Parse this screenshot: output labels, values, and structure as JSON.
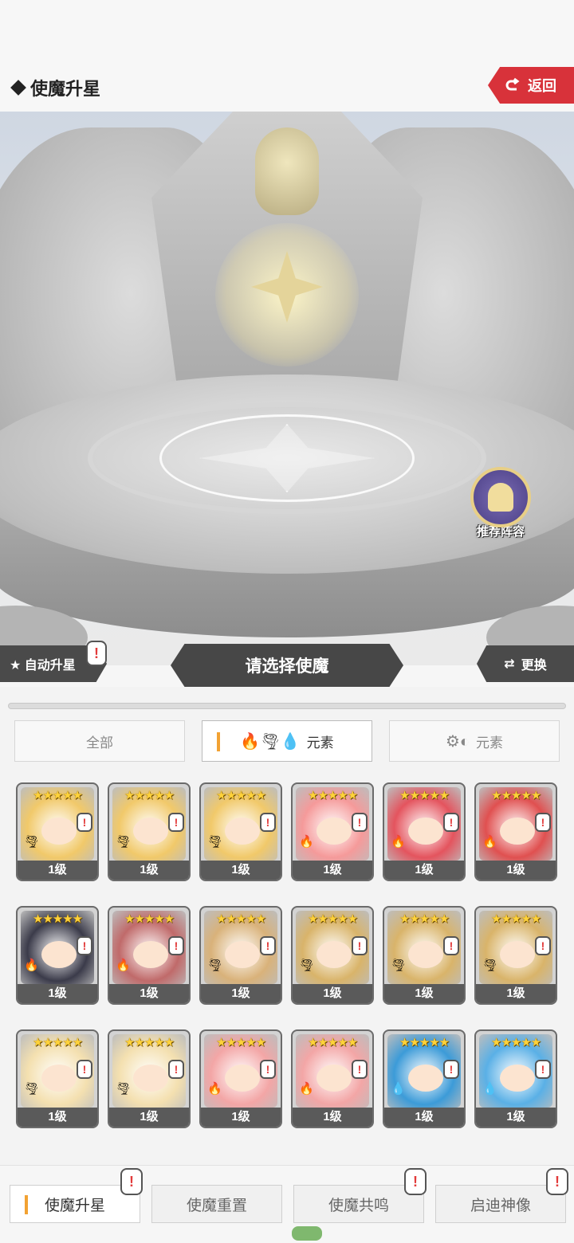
{
  "header": {
    "title": "使魔升星",
    "back_label": "返回"
  },
  "scene": {
    "recommend_label": "推荐阵容"
  },
  "actions": {
    "auto_label": "★ 自动升星",
    "select_label": "请选择使魔",
    "switch_label": "更换",
    "alert_mark": "!"
  },
  "filters": [
    {
      "label": "全部",
      "icons": ""
    },
    {
      "label": "元素",
      "icons": "🔥🌪💧"
    },
    {
      "label": "元素",
      "icons": "⚙◐"
    }
  ],
  "cards": [
    {
      "stars": "★★★★★",
      "level": "1级",
      "element": "🌪",
      "hair": "#f1c96a"
    },
    {
      "stars": "★★★★★",
      "level": "1级",
      "element": "🌪",
      "hair": "#f1c96a"
    },
    {
      "stars": "★★★★★",
      "level": "1级",
      "element": "🌪",
      "hair": "#f1c96a"
    },
    {
      "stars": "★★★★★",
      "level": "1级",
      "element": "🔥",
      "hair": "#f59a9a"
    },
    {
      "stars": "★★★★★",
      "level": "1级",
      "element": "🔥",
      "hair": "#e4545e"
    },
    {
      "stars": "★★★★★",
      "level": "1级",
      "element": "🔥",
      "hair": "#e05050"
    },
    {
      "stars": "★★★★★",
      "level": "1级",
      "element": "🔥",
      "hair": "#3b3b4a"
    },
    {
      "stars": "★★★★★",
      "level": "1级",
      "element": "🔥",
      "hair": "#c06a6a"
    },
    {
      "stars": "★★★★★",
      "level": "1级",
      "element": "🌪",
      "hair": "#d9b27a"
    },
    {
      "stars": "★★★★★",
      "level": "1级",
      "element": "🌪",
      "hair": "#d9b46a"
    },
    {
      "stars": "★★★★★",
      "level": "1级",
      "element": "🌪",
      "hair": "#d9b46a"
    },
    {
      "stars": "★★★★★",
      "level": "1级",
      "element": "🌪",
      "hair": "#d9b46a"
    },
    {
      "stars": "★★★★★",
      "level": "1级",
      "element": "🌪",
      "hair": "#f4e0b0"
    },
    {
      "stars": "★★★★★",
      "level": "1级",
      "element": "🌪",
      "hair": "#f4e0b0"
    },
    {
      "stars": "★★★★★",
      "level": "1级",
      "element": "🔥",
      "hair": "#f3a6a6"
    },
    {
      "stars": "★★★★★",
      "level": "1级",
      "element": "🔥",
      "hair": "#f3a6a6"
    },
    {
      "stars": "★★★★★",
      "level": "1级",
      "element": "💧",
      "hair": "#3c9bd8"
    },
    {
      "stars": "★★★★★",
      "level": "1级",
      "element": "💧",
      "hair": "#5ab0e6"
    }
  ],
  "tabs": [
    {
      "label": "使魔升星",
      "active": true
    },
    {
      "label": "使魔重置",
      "active": false
    },
    {
      "label": "使魔共鸣",
      "active": false
    },
    {
      "label": "启迪神像",
      "active": false
    }
  ]
}
